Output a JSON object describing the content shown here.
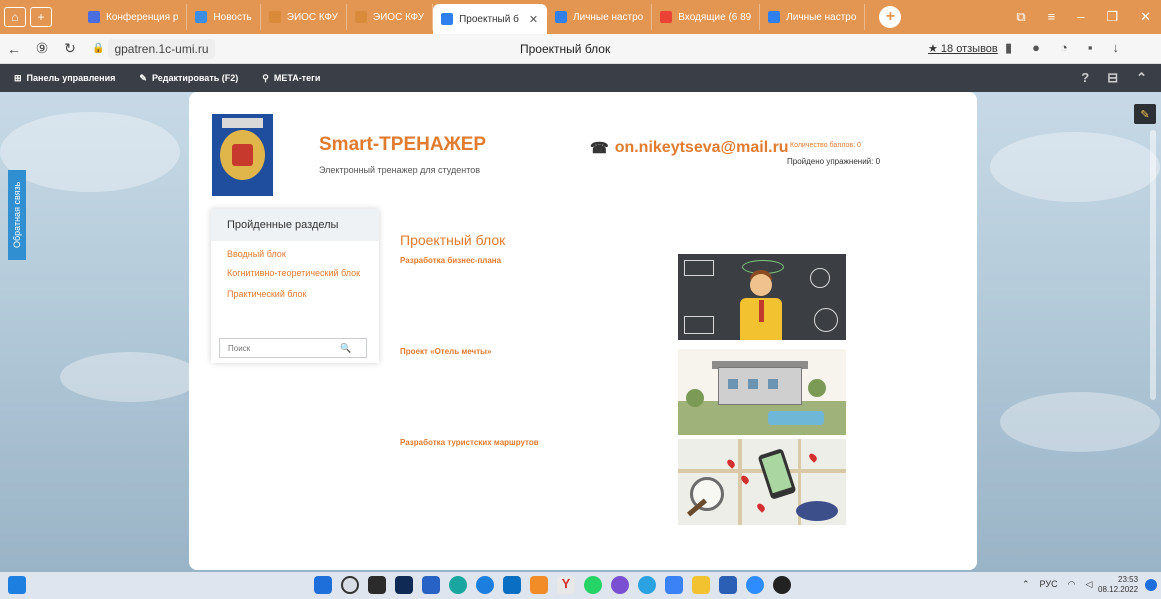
{
  "browser": {
    "tabs": [
      {
        "label": "Конференция р",
        "color": "#4a6ee0"
      },
      {
        "label": "Новость",
        "color": "#3b8ee8"
      },
      {
        "label": "ЭИОС КФУ",
        "color": "#d98b3a"
      },
      {
        "label": "ЭИОС КФУ",
        "color": "#d98b3a"
      },
      {
        "label": "Проектный б",
        "color": "#2f80ed",
        "active": true
      },
      {
        "label": "Личные настро",
        "color": "#2f80ed"
      },
      {
        "label": "Входящие (6 89",
        "color": "#ea4335"
      },
      {
        "label": "Личные настро",
        "color": "#2f80ed"
      }
    ],
    "url": "gpatren.1c-umi.ru",
    "page_title": "Проектный блок",
    "reviews": "★ 18 отзывов"
  },
  "adminbar": {
    "dashboard": "Панель управления",
    "edit": "Редактировать (F2)",
    "meta": "META-теги"
  },
  "feedback_label": "Обратная связь",
  "site": {
    "title": "Smart-ТРЕНАЖЕР",
    "subtitle": "Электронный тренажер для студентов",
    "email": "on.nikeytseva@mail.ru",
    "score": "Количество баллов: 0",
    "passed": "Пройдено упражнений: 0"
  },
  "sidebar": {
    "heading": "Пройденные разделы",
    "items": [
      "Вводный блок",
      "Когнитивно-теоретический блок",
      "Практический блок"
    ],
    "search_placeholder": "Поиск"
  },
  "main": {
    "heading": "Проектный блок",
    "projects": [
      {
        "title": "Разработка бизнес-плана"
      },
      {
        "title": "Проект «Отель мечты»"
      },
      {
        "title": "Разработка туристских маршрутов"
      }
    ]
  },
  "taskbar": {
    "lang": "РУС",
    "time": "23:53",
    "date": "08.12.2022"
  }
}
